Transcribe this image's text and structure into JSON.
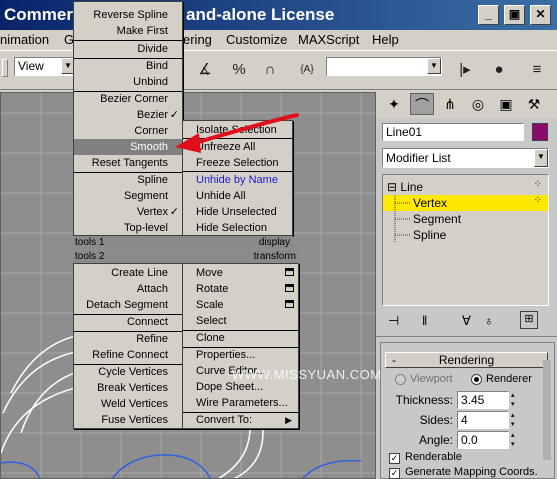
{
  "title": {
    "text": "Commerc",
    "text2": "and-alone License"
  },
  "window_buttons": {
    "minimize": "_",
    "maximize": "▣",
    "close": "✕"
  },
  "menubar": [
    "nimation",
    "G",
    "ering",
    "Customize",
    "MAXScript",
    "Help"
  ],
  "toolbar": {
    "view_combo": "View",
    "selection_combo": ""
  },
  "quad_menu": {
    "left_upper": [
      {
        "label": "Reverse Spline",
        "check": ""
      },
      {
        "label": "Make First",
        "check": ""
      },
      {
        "label": "Divide",
        "check": ""
      },
      {
        "label": "Bind",
        "check": ""
      },
      {
        "label": "Unbind",
        "check": ""
      },
      {
        "label": "Bezier Corner",
        "check": ""
      },
      {
        "label": "Bezier",
        "check": "✓"
      },
      {
        "label": "Corner",
        "check": ""
      },
      {
        "label": "Smooth",
        "check": ""
      },
      {
        "label": "Reset Tangents",
        "check": ""
      },
      {
        "label": "Spline",
        "check": ""
      },
      {
        "label": "Segment",
        "check": ""
      },
      {
        "label": "Vertex",
        "check": "✓"
      },
      {
        "label": "Top-level",
        "check": ""
      }
    ],
    "right_upper": [
      "Isolate Selection",
      "Unfreeze All",
      "Freeze Selection",
      "Unhide by Name",
      "Unhide All",
      "Hide Unselected",
      "Hide Selection"
    ],
    "headers": {
      "tools1": "tools 1",
      "display": "display",
      "tools2": "tools 2",
      "transform": "transform"
    },
    "left_lower": [
      "Create Line",
      "Attach",
      "Detach Segment",
      "Connect",
      "Refine",
      "Refine Connect",
      "Cycle Vertices",
      "Break Vertices",
      "Weld Vertices",
      "Fuse Vertices"
    ],
    "right_lower": [
      "Move",
      "Rotate",
      "Scale",
      "Select",
      "Clone",
      "Properties...",
      "Curve Editor...",
      "Dope Sheet...",
      "Wire Parameters...",
      "Convert To:"
    ],
    "convert_arrow": "▶"
  },
  "watermark": "WWW.MISSYUAN.COM",
  "command_panel": {
    "object_name": "Line01",
    "object_color": "#8b0a6e",
    "modifier_list": "Modifier List",
    "stack": [
      {
        "label": "Line",
        "prefix": "⊟",
        "selected": false
      },
      {
        "label": "Vertex",
        "prefix": "",
        "selected": true
      },
      {
        "label": "Segment",
        "prefix": "",
        "selected": false
      },
      {
        "label": "Spline",
        "prefix": "",
        "selected": false
      }
    ],
    "rollout_minus": "-",
    "rollout_title": "Rendering",
    "viewport_label": "Viewport",
    "renderer_label": "Renderer",
    "thickness_label": "Thickness:",
    "thickness": "3.45",
    "sides_label": "Sides:",
    "sides": "4",
    "angle_label": "Angle:",
    "angle": "0.0",
    "renderable_label": "Renderable",
    "gen_mapping_label": "Generate Mapping Coords."
  },
  "colors": {
    "highlight_yellow": "#ffe800",
    "arrow_red": "#e0101a",
    "title_blue": "#0a246a",
    "link_blue": "#1a1ad0"
  }
}
